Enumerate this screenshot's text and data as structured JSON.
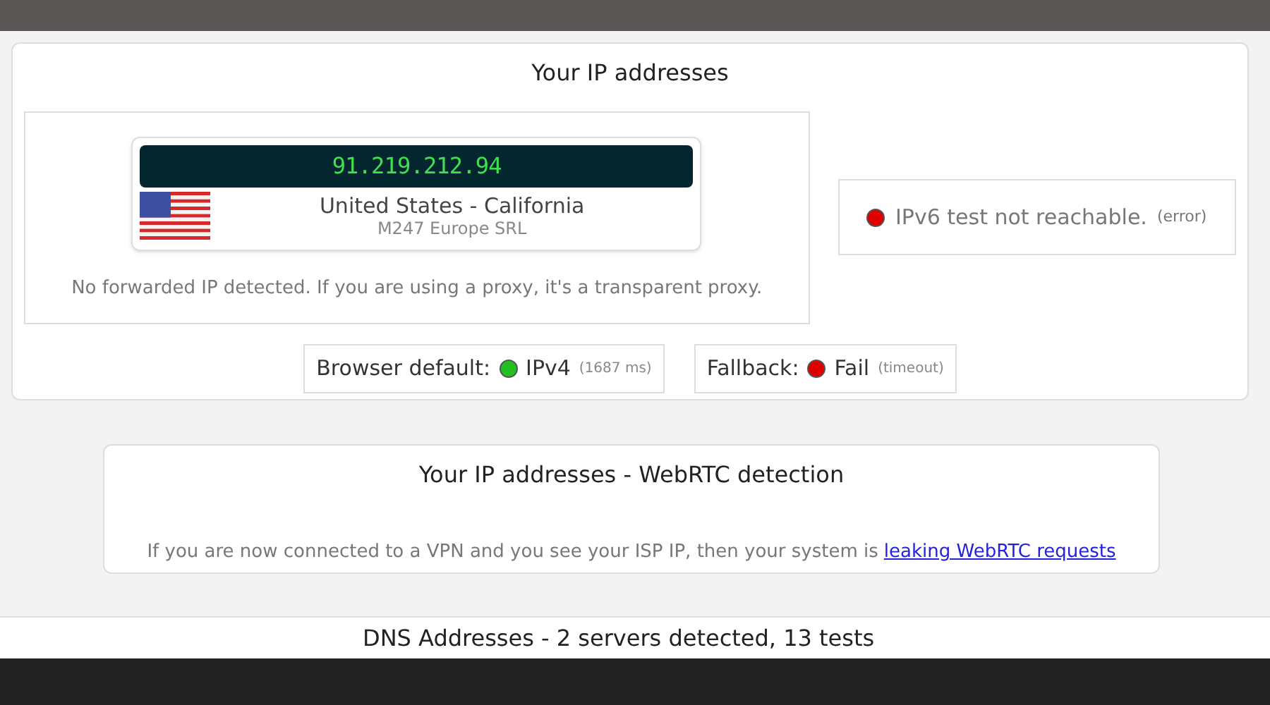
{
  "ip_panel": {
    "title": "Your IP addresses",
    "ip_card": {
      "ip": "91.219.212.94",
      "location": "United States - California",
      "isp": "M247 Europe SRL"
    },
    "forwarded_note": "No forwarded IP detected. If you are using a proxy, it's a transparent proxy.",
    "ipv6": {
      "color": "#e00000",
      "text": "IPv6 test not reachable.",
      "note": "(error)"
    },
    "checks": [
      {
        "label": "Browser default:",
        "color": "#22c022",
        "value": "IPv4",
        "note": "(1687 ms)"
      },
      {
        "label": "Fallback:",
        "color": "#e00000",
        "value": "Fail",
        "note": "(timeout)"
      }
    ]
  },
  "webrtc_panel": {
    "title": "Your IP addresses - WebRTC detection",
    "note": "If you are now connected to a VPN and you see your ISP IP, then your system is",
    "link": "leaking WebRTC requests"
  },
  "dns_heading": "DNS Addresses - 2 servers detected, 13 tests"
}
